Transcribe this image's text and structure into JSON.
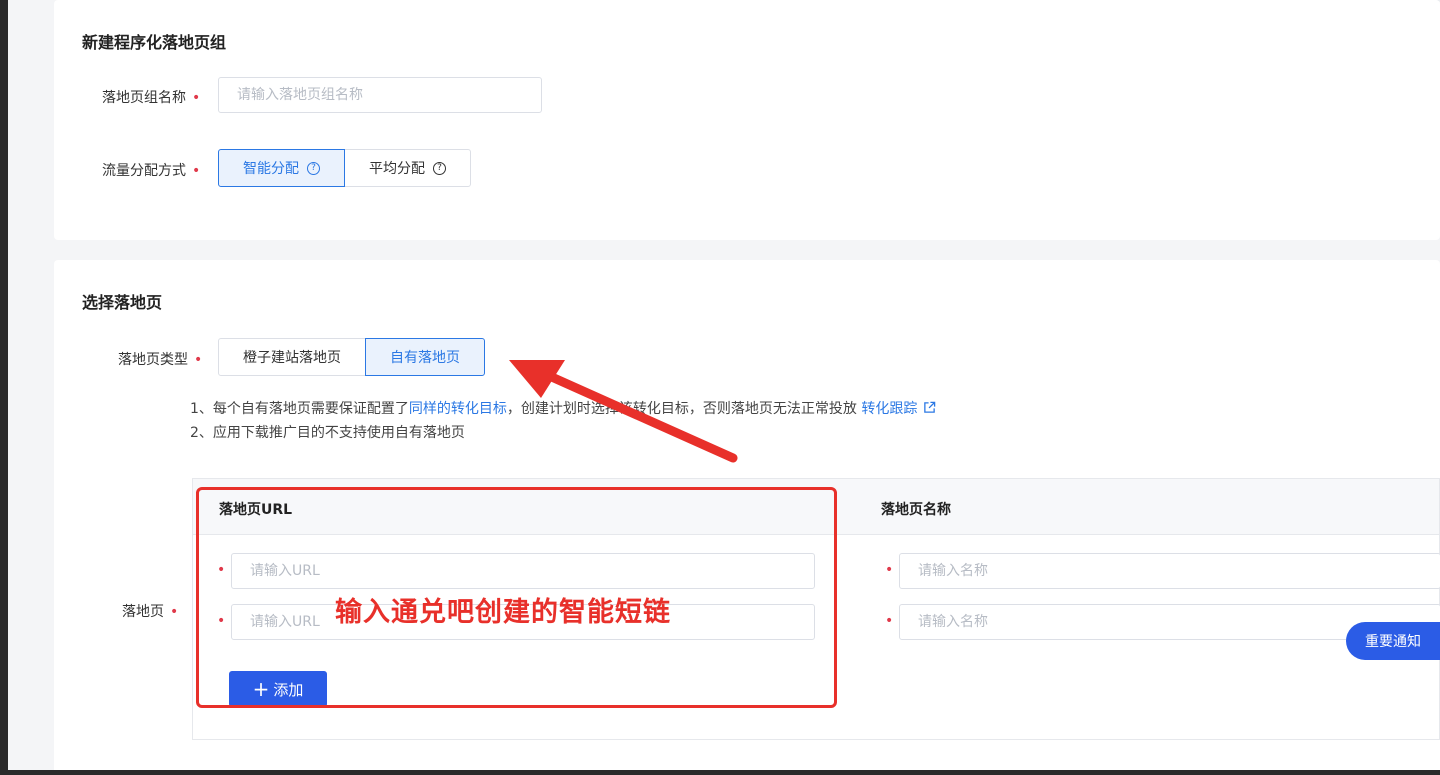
{
  "group_section": {
    "title": "新建程序化落地页组",
    "name_label": "落地页组名称",
    "name_placeholder": "请输入落地页组名称",
    "traffic_label": "流量分配方式",
    "traffic_options": [
      "智能分配",
      "平均分配"
    ],
    "traffic_selected": "智能分配"
  },
  "select_section": {
    "title": "选择落地页",
    "type_label": "落地页类型",
    "type_options": [
      "橙子建站落地页",
      "自有落地页"
    ],
    "type_selected": "自有落地页",
    "note1_prefix": "1、每个自有落地页需要保证配置了",
    "note1_link": "同样的转化目标",
    "note1_mid": "，创建计划时选择该转化目标，否则落地页无法正常投放",
    "note1_link2": "转化跟踪",
    "note2": "2、应用下载推广目的不支持使用自有落地页",
    "landing_label": "落地页",
    "table": {
      "col_url": "落地页URL",
      "col_name": "落地页名称",
      "url_placeholder": "请输入URL",
      "name_placeholder": "请输入名称",
      "add_label": "添加"
    }
  },
  "annotation": {
    "text": "输入通兑吧创建的智能短链",
    "color": "#e8302a"
  },
  "notice_button": "重要通知",
  "colors": {
    "accent": "#2b78e4",
    "primary_button": "#2b5ce6",
    "required": "#e0394a"
  }
}
